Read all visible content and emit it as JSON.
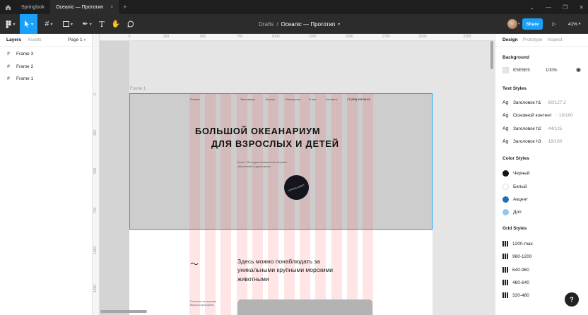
{
  "titlebar": {
    "tabs": [
      {
        "label": "Springlook",
        "active": false
      },
      {
        "label": "Oceanic — Прототип",
        "active": true
      }
    ],
    "plus": "+",
    "close": "×"
  },
  "toolbar": {
    "breadcrumb_parent": "Drafts",
    "breadcrumb_sep": "/",
    "breadcrumb_current": "Oceanic — Прототип",
    "share_label": "Share",
    "zoom_label": "41%"
  },
  "left_panel": {
    "tab_layers": "Layers",
    "tab_assets": "Assets",
    "page_label": "Page 1",
    "layers": [
      "Frame 3",
      "Frame 2",
      "Frame 1"
    ]
  },
  "canvas": {
    "ruler_x": [
      "0",
      "250",
      "500",
      "750",
      "1000",
      "1250",
      "1500",
      "1750",
      "2000",
      "2250"
    ],
    "ruler_y": [
      "0",
      "250",
      "500",
      "750",
      "1000",
      "1250"
    ],
    "frame_label": "Frame 1",
    "nav": [
      "Oceanic",
      "Экспозиция",
      "Билеты",
      "Распису нас",
      "О нас",
      "Контакты",
      "+7 (999) 999-99-99"
    ],
    "hero_line1": "БОЛЬШОЙ ОКЕАНАРИУМ",
    "hero_line2": "ДЛЯ ВЗРОСЛЫХ И ДЕТЕЙ",
    "hero_sub": "Более 750 видов  океанических морских обитателей в одном месте",
    "cta_label": "КУПИТЬ БИЛЕТ",
    "wave": "〜",
    "section_text": "Здесь можно понаблюдать за уникальными крупными морскими животными",
    "section_small": "Посетите нас  акулами Вируса и дельфины"
  },
  "right_panel": {
    "tab_design": "Design",
    "tab_prototype": "Prototype",
    "tab_inspect": "Inspect",
    "background_title": "Background",
    "background_hex": "E5E5E5",
    "background_opacity": "100%",
    "text_styles_title": "Text Styles",
    "text_styles": [
      {
        "name": "Заголовок h1",
        "spec": "· 60/127.2"
      },
      {
        "name": "Основной контент",
        "spec": "· 18/160"
      },
      {
        "name": "Заголовок h2",
        "spec": "· 44/125"
      },
      {
        "name": "Заголовок h3",
        "spec": "· 18/160"
      }
    ],
    "color_styles_title": "Color Styles",
    "color_styles": [
      {
        "name": "Черный",
        "color": "#151515"
      },
      {
        "name": "Белый",
        "color": "#ffffff"
      },
      {
        "name": "Акцент",
        "color": "#1e6fb8"
      },
      {
        "name": "Доп",
        "color": "#8fc8f0"
      }
    ],
    "grid_styles_title": "Grid Styles",
    "grid_styles": [
      "1200-max",
      "960-1200",
      "640-960",
      "480-640",
      "320-480"
    ]
  },
  "colors": {
    "accent": "#18a0fb",
    "canvas_bg": "#e5e5e5",
    "grid_column": "#ff4646"
  },
  "help_label": "?"
}
